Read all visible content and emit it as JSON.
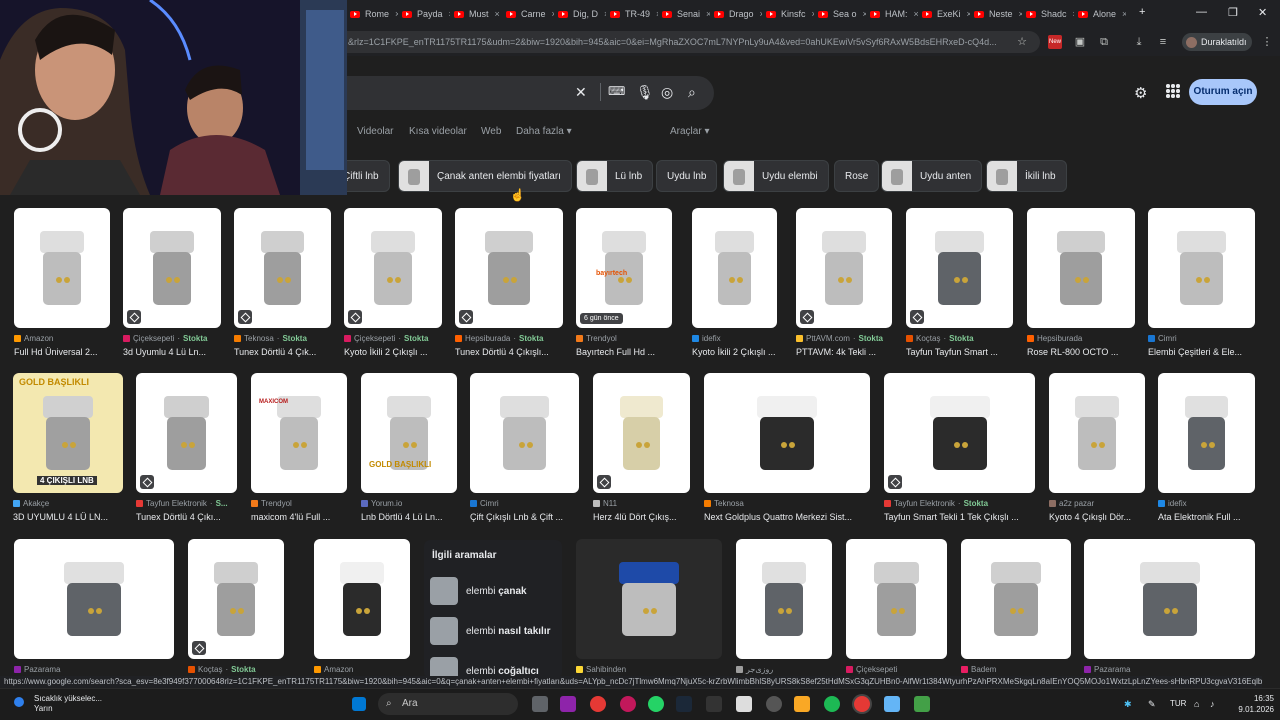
{
  "browser": {
    "tabs": [
      {
        "label": "Rome"
      },
      {
        "label": "Payda"
      },
      {
        "label": "Must"
      },
      {
        "label": "Carne"
      },
      {
        "label": "Dig, D"
      },
      {
        "label": "TR-49"
      },
      {
        "label": "Senai"
      },
      {
        "label": "Drago"
      },
      {
        "label": "Kinsfc"
      },
      {
        "label": "Sea o"
      },
      {
        "label": "HAM:"
      },
      {
        "label": "ExeKi"
      },
      {
        "label": "Neste"
      },
      {
        "label": "Shadc"
      },
      {
        "label": "Alone"
      }
    ],
    "new_tab_glyph": "+",
    "url": "&rlz=1C1FKPE_enTR1175TR1175&udm=2&biw=1920&bih=945&aic=0&ei=MgRhaZXOC7mL7NYPnLy9uA4&ved=0ahUKEwiVr5vSyf6RAxW5BdsEHRxeD-cQ4d...",
    "profile_label": "Duraklatıldı",
    "new_badge": "New"
  },
  "search": {
    "signin_label": "Oturum açın",
    "nav_tabs": [
      "Videolar",
      "Kısa videolar",
      "Web",
      "Daha fazla",
      "Araçlar"
    ],
    "chips": [
      {
        "label": "Çiftli lnb",
        "img": false
      },
      {
        "label": "Çanak anten elembi fiyatları",
        "img": true
      },
      {
        "label": "Lü lnb",
        "img": true
      },
      {
        "label": "Uydu lnb",
        "img": false
      },
      {
        "label": "Uydu elembi",
        "img": true
      },
      {
        "label": "Rose",
        "img": false
      },
      {
        "label": "Uydu anten",
        "img": true
      },
      {
        "label": "İkili lnb",
        "img": true
      }
    ]
  },
  "results": [
    {
      "source": "Amazon",
      "stock": "",
      "title": "Full Hd Üniversal 2...",
      "fav": "#ff9900",
      "badge": "",
      "tag": false
    },
    {
      "source": "Çiçeksepeti",
      "stock": "Stokta",
      "title": "3d Uyumlu 4 Lü Ln...",
      "fav": "#d81b60",
      "badge": "",
      "tag": true
    },
    {
      "source": "Teknosa",
      "stock": "Stokta",
      "title": "Tunex Dörtlü 4 Çık...",
      "fav": "#f57c00",
      "badge": "",
      "tag": true
    },
    {
      "source": "Çiçeksepeti",
      "stock": "Stokta",
      "title": "Kyoto İkili 2 Çıkışlı ...",
      "fav": "#d81b60",
      "badge": "",
      "tag": true
    },
    {
      "source": "Hepsiburada",
      "stock": "Stokta",
      "title": "Tunex Dörtlü 4 Çıkışlı...",
      "fav": "#ff6000",
      "badge": "",
      "tag": true
    },
    {
      "source": "Trendyol",
      "stock": "",
      "title": "Bayırtech Full Hd ...",
      "fav": "#f27a1a",
      "badge": "6 gün önce",
      "tag": false
    },
    {
      "source": "idefix",
      "stock": "",
      "title": "Kyoto İkili 2 Çıkışlı ...",
      "fav": "#1e88e5",
      "badge": "",
      "tag": false
    },
    {
      "source": "PttAVM.com",
      "stock": "Stokta",
      "title": "PTTAVM: 4k Tekli ...",
      "fav": "#fbc02d",
      "badge": "",
      "tag": true
    },
    {
      "source": "Koçtaş",
      "stock": "Stokta",
      "title": "Tayfun Tayfun Smart ...",
      "fav": "#e65100",
      "badge": "",
      "tag": true
    },
    {
      "source": "Hepsiburada",
      "stock": "",
      "title": "Rose RL-800 OCTO ...",
      "fav": "#ff6000",
      "badge": "",
      "tag": false
    },
    {
      "source": "Cimri",
      "stock": "",
      "title": "Elembi Çeşitleri & Ele...",
      "fav": "#1976d2",
      "badge": "",
      "tag": false
    },
    {
      "source": "Akakçe",
      "stock": "",
      "title": "3D UYUMLU 4 LÜ LN...",
      "fav": "#42a5f5",
      "badge": "",
      "tag": false
    },
    {
      "source": "Tayfun Elektronik",
      "stock": "S...",
      "title": "Tunex Dörtlü 4 Çıkı...",
      "fav": "#e53935",
      "badge": "",
      "tag": true
    },
    {
      "source": "Trendyol",
      "stock": "",
      "title": "maxicom 4'lü Full ...",
      "fav": "#f27a1a",
      "badge": "",
      "tag": false
    },
    {
      "source": "Yorum.io",
      "stock": "",
      "title": "Lnb Dörtlü 4 Lü Ln...",
      "fav": "#5c6bc0",
      "badge": "",
      "tag": false
    },
    {
      "source": "Cimri",
      "stock": "",
      "title": "Çift Çıkışlı Lnb & Çift ...",
      "fav": "#1976d2",
      "badge": "",
      "tag": false
    },
    {
      "source": "N11",
      "stock": "",
      "title": "Herz 4lü Dört Çıkış...",
      "fav": "#bdbdbd",
      "badge": "",
      "tag": true
    },
    {
      "source": "Teknosa",
      "stock": "",
      "title": "Next Goldplus Quattro Merkezi Sist...",
      "fav": "#f57c00",
      "badge": "",
      "tag": false
    },
    {
      "source": "Tayfun Elektronik",
      "stock": "Stokta",
      "title": "Tayfun Smart Tekli 1 Tek Çıkışlı ...",
      "fav": "#e53935",
      "badge": "",
      "tag": true
    },
    {
      "source": "a2z pazar",
      "stock": "",
      "title": "Kyoto 4 Çıkışlı Dör...",
      "fav": "#8d6e63",
      "badge": "",
      "tag": false
    },
    {
      "source": "idefix",
      "stock": "",
      "title": "Ata Elektronik Full ...",
      "fav": "#1e88e5",
      "badge": "",
      "tag": false
    },
    {
      "source": "Pazarama",
      "stock": "",
      "title": "",
      "fav": "#8e24aa",
      "badge": "",
      "tag": false
    },
    {
      "source": "Koçtaş",
      "stock": "Stokta",
      "title": "",
      "fav": "#e65100",
      "badge": "",
      "tag": true
    },
    {
      "source": "Amazon",
      "stock": "",
      "title": "",
      "fav": "#ff9900",
      "badge": "",
      "tag": false
    },
    {
      "source": "Sahibinden",
      "stock": "",
      "title": "",
      "fav": "#fdd835",
      "badge": "",
      "tag": false
    },
    {
      "source": "روزی‌جر",
      "stock": "",
      "title": "",
      "fav": "#9e9e9e",
      "badge": "",
      "tag": false
    },
    {
      "source": "Çiçeksepeti",
      "stock": "",
      "title": "",
      "fav": "#d81b60",
      "badge": "",
      "tag": false
    },
    {
      "source": "Badem",
      "stock": "",
      "title": "",
      "fav": "#e91e63",
      "badge": "",
      "tag": false
    },
    {
      "source": "Pazarama",
      "stock": "",
      "title": "",
      "fav": "#8e24aa",
      "badge": "",
      "tag": false
    }
  ],
  "image_text": {
    "gold_baslikli": "GOLD BAŞLIKLI",
    "four_output": "4 ÇIKIŞLI LNB",
    "brand": "bayırtech",
    "maxicom": "MAXICOM"
  },
  "related": {
    "heading": "İlgili aramalar",
    "items": [
      {
        "prefix": "elembi ",
        "bold": "çanak"
      },
      {
        "prefix": "elembi ",
        "bold": "nasıl takılır"
      },
      {
        "prefix": "elembi ",
        "bold": "coğaltıcı"
      }
    ]
  },
  "status_url": "https://www.google.com/search?sca_esv=8e3f949f377000648rlz=1C1FKPE_enTR1175TR1175&biw=1920&bih=945&aic=0&q=çanak+anten+elembi+fiyatları&uds=ALYpb_ncDc7jTlmw6Mmq7NjuX5c-krZrbWlimbBhlS8yURS8kS8ef25tHdMSxG3qZUHBn0-AlfWr1t384WtyurhPzAhPRXMeSkgqLn8aIEnYOQ5MOJo1WxtzLpLnZYees-sHbnRPU3cgvaV316Eqlb0y...",
  "taskbar": {
    "weather_line1": "Sıcaklık yükselec...",
    "weather_line2": "Yarın",
    "search_label": "Ara",
    "lang": "TUR",
    "time": "16:35",
    "date": "9.01.2026"
  },
  "colors": {
    "accent": "#a8c7fa",
    "bg": "#1f1f1f",
    "stock": "#81c995"
  }
}
